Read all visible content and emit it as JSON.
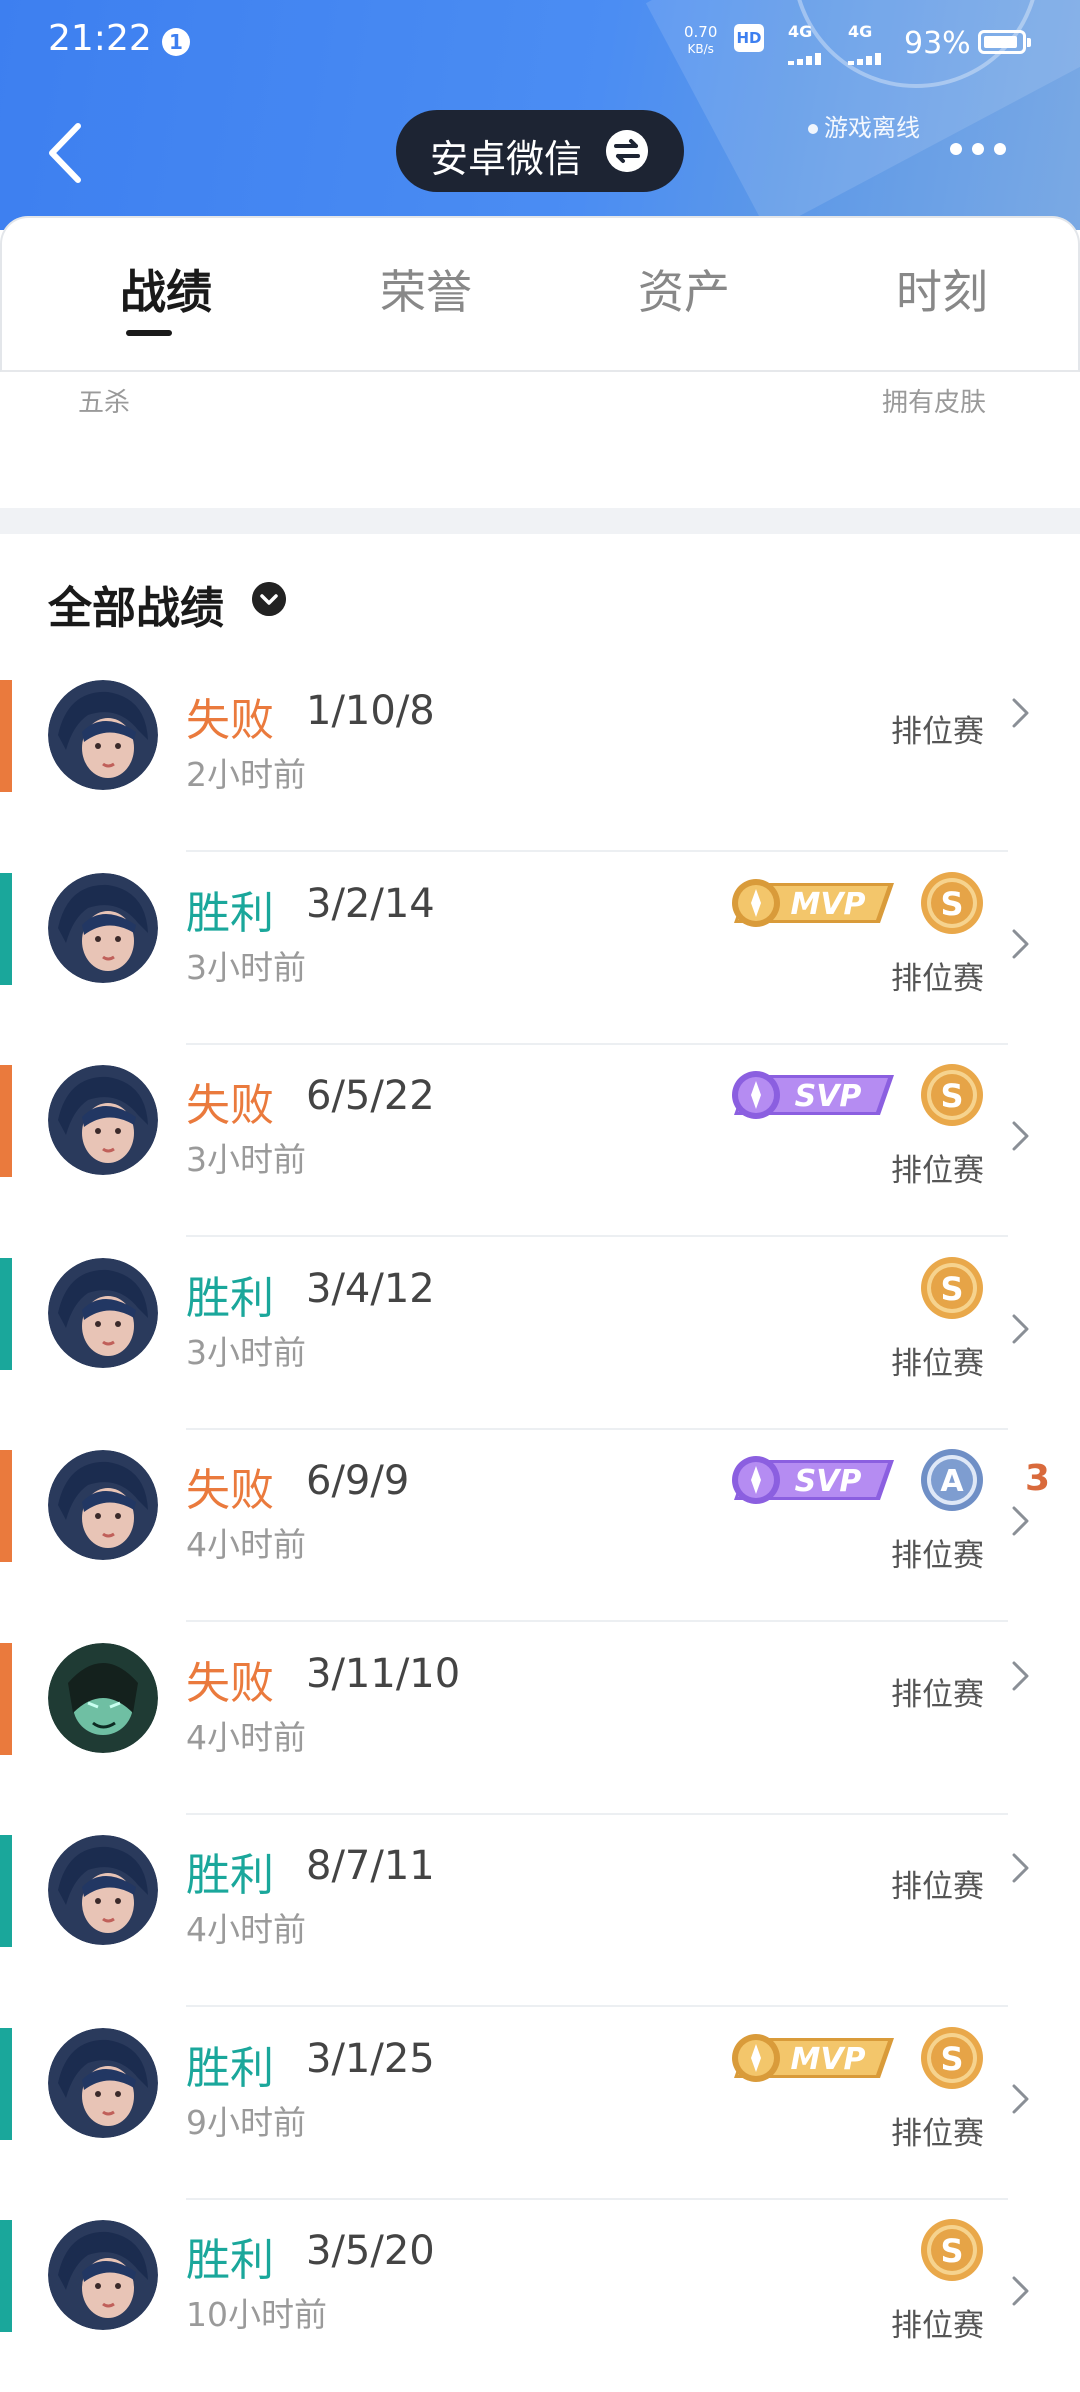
{
  "status_bar": {
    "time": "21:22",
    "notification_count": "1",
    "net_speed_value": "0.70",
    "net_speed_unit": "KB/s",
    "hd": "HD",
    "sim1": "4G",
    "sim2": "4G",
    "battery_pct": "93%",
    "battery_level": 0.93
  },
  "header": {
    "account": "安卓微信",
    "status": "游戏离线"
  },
  "tabs": [
    {
      "label": "战绩"
    },
    {
      "label": "荣誉"
    },
    {
      "label": "资产"
    },
    {
      "label": "时刻"
    }
  ],
  "stats_labels": {
    "left": "五杀",
    "right": "拥有皮肤"
  },
  "section": {
    "title": "全部战绩"
  },
  "colors": {
    "win": "#1aa79b",
    "loss": "#ea7a3d"
  },
  "matches": [
    {
      "result": "失败",
      "kda": "1/10/8",
      "ago": "2小时前",
      "mode": "排位赛",
      "badges": [],
      "avatar": "hero-a"
    },
    {
      "result": "胜利",
      "kda": "3/2/14",
      "ago": "3小时前",
      "mode": "排位赛",
      "badges": [
        "MVP",
        "S"
      ],
      "avatar": "hero-a"
    },
    {
      "result": "失败",
      "kda": "6/5/22",
      "ago": "3小时前",
      "mode": "排位赛",
      "badges": [
        "SVP",
        "S"
      ],
      "avatar": "hero-a"
    },
    {
      "result": "胜利",
      "kda": "3/4/12",
      "ago": "3小时前",
      "mode": "排位赛",
      "badges": [
        "S"
      ],
      "avatar": "hero-a"
    },
    {
      "result": "失败",
      "kda": "6/9/9",
      "ago": "4小时前",
      "mode": "排位赛",
      "badges": [
        "SVP",
        "A",
        "3"
      ],
      "avatar": "hero-a"
    },
    {
      "result": "失败",
      "kda": "3/11/10",
      "ago": "4小时前",
      "mode": "排位赛",
      "badges": [],
      "avatar": "hero-b"
    },
    {
      "result": "胜利",
      "kda": "8/7/11",
      "ago": "4小时前",
      "mode": "排位赛",
      "badges": [],
      "avatar": "hero-a"
    },
    {
      "result": "胜利",
      "kda": "3/1/25",
      "ago": "9小时前",
      "mode": "排位赛",
      "badges": [
        "MVP",
        "S"
      ],
      "avatar": "hero-a"
    },
    {
      "result": "胜利",
      "kda": "3/5/20",
      "ago": "10小时前",
      "mode": "排位赛",
      "badges": [
        "S"
      ],
      "avatar": "hero-a"
    }
  ]
}
